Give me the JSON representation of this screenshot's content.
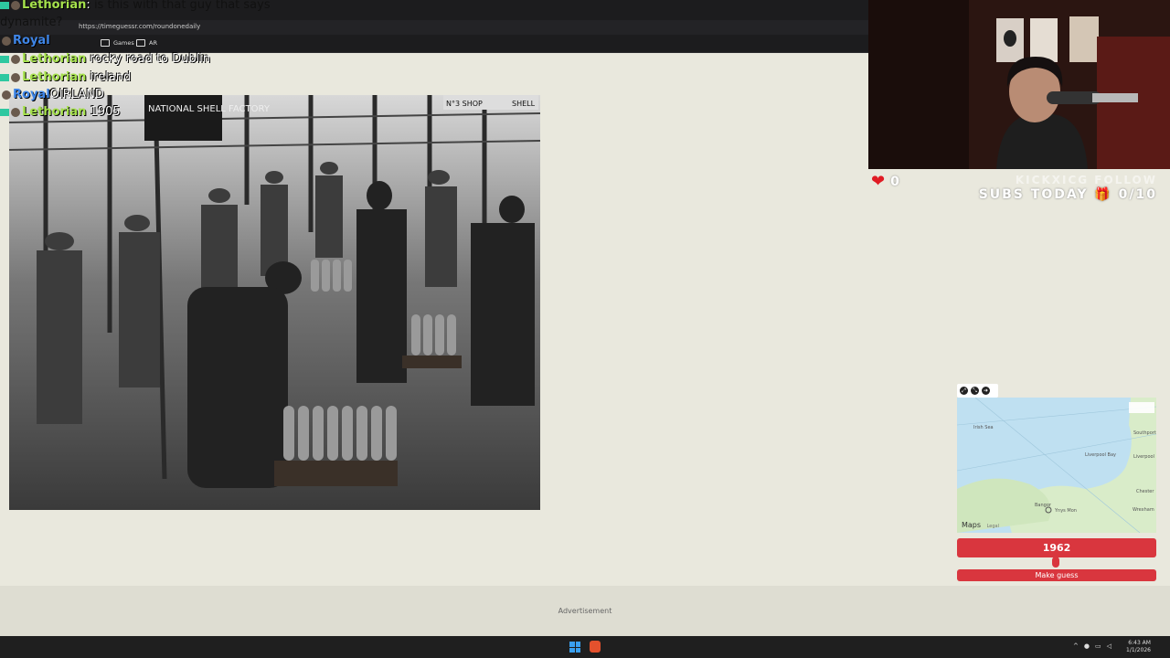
{
  "browser": {
    "url": "https://timeguessr.com/roundonedaily",
    "bookmarks": [
      {
        "label": "Games"
      },
      {
        "label": "AR"
      }
    ]
  },
  "chat": [
    {
      "user": "Lethorian",
      "sep": ":",
      "text": "is this with that guy that says"
    },
    {
      "user": "",
      "sep": "",
      "text": "dynamite?"
    },
    {
      "user": "Royal",
      "sep": "",
      "text": ""
    },
    {
      "user": "Lethorian",
      "sep": "",
      "text": "rocky road to Dublin"
    },
    {
      "user": "Lethorian",
      "sep": "",
      "text": "ireland"
    },
    {
      "user": "Royal",
      "sep": "",
      "text": "OIRLAND"
    },
    {
      "user": "Lethorian",
      "sep": "",
      "text": "1905"
    }
  ],
  "photo": {
    "sign_left": "NATIONAL SHELL FACTORY",
    "sign_right_1": "N°3 SHOP",
    "sign_right_2": "SHELL"
  },
  "overlay": {
    "heart_count": "0",
    "follow_text": "KICKXICG FOLLOW",
    "subs_text": "SUBS TODAY 🎁 0/10"
  },
  "map": {
    "attribution": "Maps",
    "legal": "Legal",
    "places": [
      "Irish Sea",
      "Liverpool",
      "Southport",
      "Chester",
      "Wrexham",
      "Bangor",
      "Ynys Mon",
      "Liverpool Bay"
    ]
  },
  "guess": {
    "year": "1962",
    "year_fraction": 0.48,
    "button_label": "Make guess"
  },
  "ad": {
    "label": "Advertisement"
  },
  "taskbar": {
    "time": "6:43 AM",
    "date": "1/1/2026"
  }
}
